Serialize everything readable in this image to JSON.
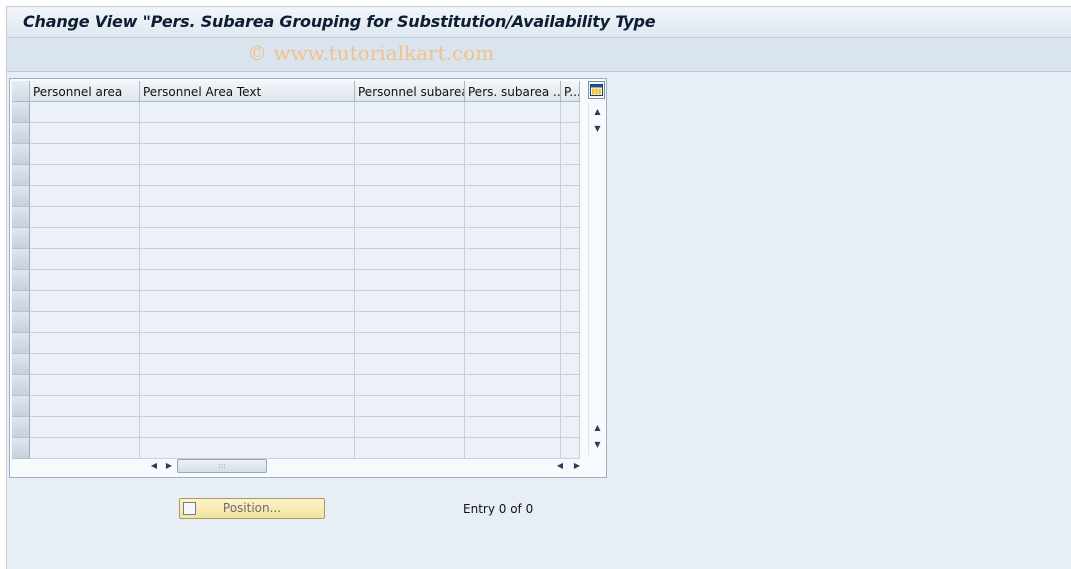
{
  "window": {
    "title": "Change View \"Pers. Subarea Grouping for Substitution/Availability Type",
    "watermark": "© www.tutorialkart.com"
  },
  "table": {
    "columns": [
      "Personnel area",
      "Personnel Area Text",
      "Personnel subarea",
      "Pers. subarea ...",
      "P..."
    ],
    "rows": []
  },
  "footer": {
    "position_button_label": "Position...",
    "entry_text": "Entry 0 of 0"
  },
  "icons": {
    "config": "table-settings-icon",
    "scroll_up": "up-arrow-icon",
    "scroll_down": "down-arrow-icon",
    "scroll_left": "left-arrow-icon",
    "scroll_right": "right-arrow-icon",
    "position": "position-icon"
  },
  "colors": {
    "background": "#e8eef5",
    "header": "#dde5ee",
    "cell": "#ebf1f7",
    "button": "#f3e3a1",
    "watermark": "#f2c08a"
  }
}
